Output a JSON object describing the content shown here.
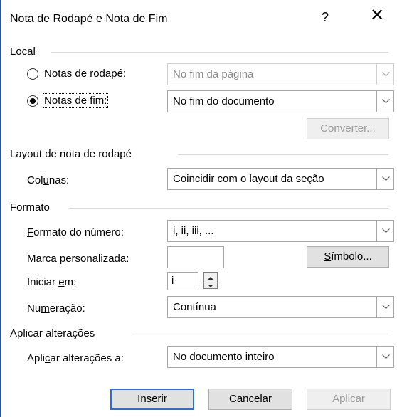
{
  "dialog": {
    "title": "Nota de Rodapé e Nota de Fim",
    "help": "?",
    "close": "✕"
  },
  "local": {
    "heading": "Local",
    "footnotes": {
      "pre": "N",
      "underline": "o",
      "post": "tas de rodapé:",
      "value": "No fim da página",
      "selected": false
    },
    "endnotes": {
      "underline": "N",
      "post": "otas de fim:",
      "value": "No fim do documento",
      "selected": true
    },
    "convert_label": "Converter..."
  },
  "layout": {
    "heading": "Layout de nota de rodapé",
    "columns": {
      "pre": "Col",
      "underline": "u",
      "post": "nas:",
      "value": "Coincidir com o layout da seção"
    }
  },
  "format": {
    "heading": "Formato",
    "number_format": {
      "underline": "F",
      "post": "ormato do número:",
      "value": "i, ii, iii, ..."
    },
    "custom_mark": {
      "pre": "Marca ",
      "underline": "p",
      "post": "ersonalizada:",
      "value": ""
    },
    "symbol": {
      "underline": "S",
      "post": "ímbolo..."
    },
    "start_at": {
      "pre": "Iniciar ",
      "underline": "e",
      "post": "m:",
      "value": "i"
    },
    "numbering": {
      "pre": "Nu",
      "underline": "m",
      "post": "eração:",
      "value": "Contínua"
    }
  },
  "apply": {
    "heading": "Aplicar alterações",
    "apply_to": {
      "pre": "Apli",
      "underline": "c",
      "post": "ar alterações a:",
      "value": "No documento inteiro"
    }
  },
  "buttons": {
    "insert": {
      "underline": "I",
      "post": "nserir"
    },
    "cancel": "Cancelar",
    "apply": "Aplicar"
  }
}
